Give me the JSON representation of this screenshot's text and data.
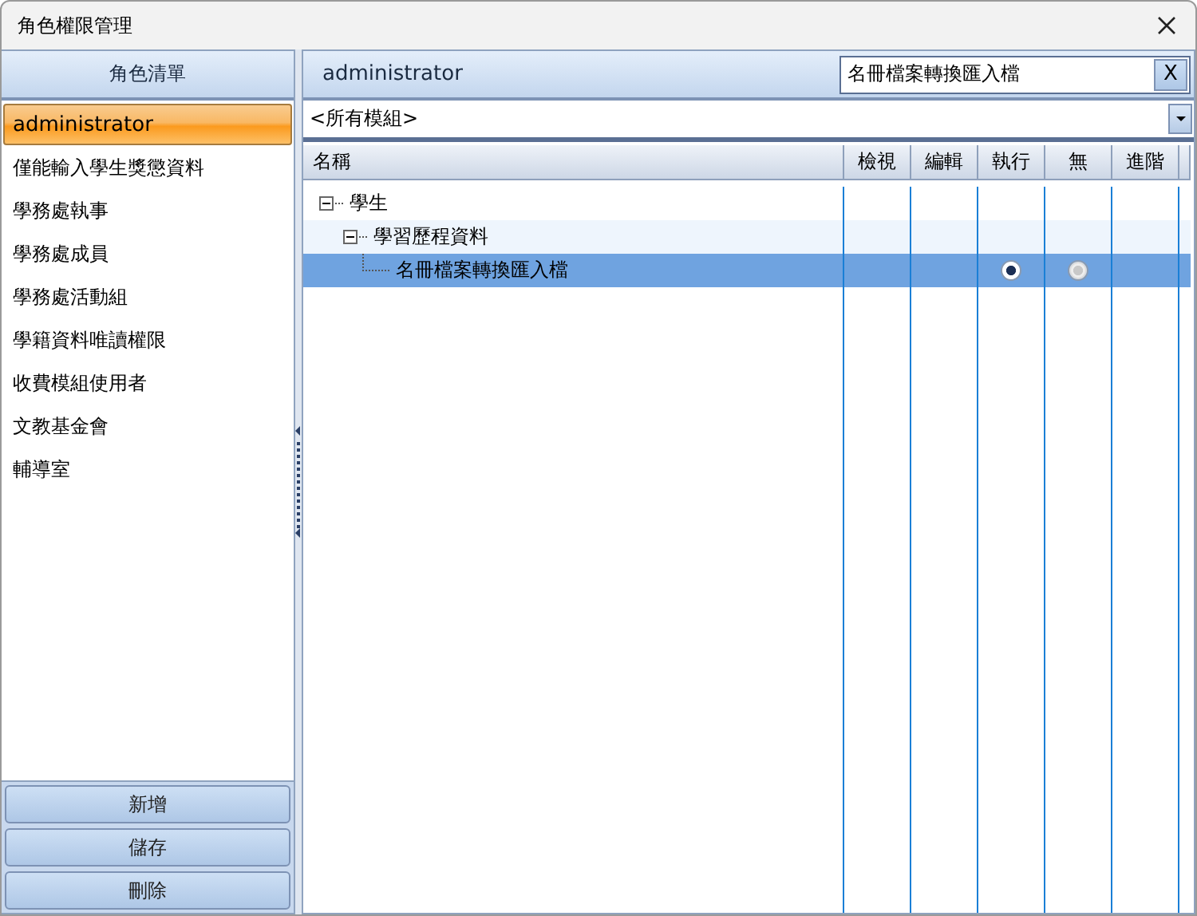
{
  "window": {
    "title": "角色權限管理"
  },
  "roles": {
    "header": "角色清單",
    "items": [
      {
        "label": "administrator",
        "selected": true
      },
      {
        "label": "僅能輸入學生獎懲資料",
        "selected": false
      },
      {
        "label": "學務處執事",
        "selected": false
      },
      {
        "label": "學務處成員",
        "selected": false
      },
      {
        "label": "學務處活動組",
        "selected": false
      },
      {
        "label": "學籍資料唯讀權限",
        "selected": false
      },
      {
        "label": "收費模組使用者",
        "selected": false
      },
      {
        "label": "文教基金會",
        "selected": false
      },
      {
        "label": "輔導室",
        "selected": false
      }
    ],
    "buttons": [
      "新增",
      "儲存",
      "刪除"
    ]
  },
  "detail": {
    "title": "administrator",
    "search": {
      "value": "名冊檔案轉換匯入檔",
      "clear": "X"
    },
    "module": "<所有模組>",
    "columns": [
      "名稱",
      "檢視",
      "編輯",
      "執行",
      "無",
      "進階"
    ],
    "tree": [
      {
        "label": "學生",
        "expanded": true,
        "selected": false,
        "children": [
          {
            "label": "學習歷程資料",
            "expanded": true,
            "selected": false,
            "children": [
              {
                "label": "名冊檔案轉換匯入檔",
                "selected": true,
                "permissions": {
                  "execute": {
                    "checked": true
                  },
                  "none": {
                    "checked": false
                  }
                }
              }
            ]
          }
        ]
      }
    ]
  }
}
